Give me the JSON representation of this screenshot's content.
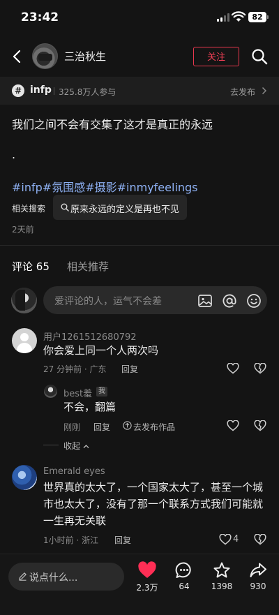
{
  "status": {
    "time": "23:42",
    "battery": "82"
  },
  "nav": {
    "username": "三治秋生",
    "follow_label": "关注"
  },
  "topic": {
    "name": "infp",
    "count": "325.8万人参与",
    "action": "去发布"
  },
  "post": {
    "text": "我们之间不会有交集了这才是真正的永远",
    "dot": ".",
    "hashtags": [
      "#infp",
      "#氛围感",
      "#摄影",
      "#inmyfeelings"
    ],
    "related_label": "相关搜索",
    "related_query": "原来永远的定义是再也不见",
    "time": "2天前"
  },
  "tabs": {
    "comments_label": "评论",
    "comments_count": "65",
    "related_label": "相关推荐"
  },
  "comment_input": {
    "placeholder": "爱评论的人，运气不会差"
  },
  "comments": [
    {
      "user": "用户1261512680792",
      "text": "你会爱上同一个人两次吗",
      "meta": "27 分钟前 · 广东",
      "reply_label": "回复",
      "likes": ""
    },
    {
      "user": "Emerald eyes",
      "text": "世界真的太大了，一个国家太大了，甚至一个城市也太大了，没有了那一个联系方式我们可能就一生再无关联",
      "meta": "1小时前 · 浙江",
      "reply_label": "回复",
      "likes": "4"
    }
  ],
  "reply": {
    "user": "best羞",
    "tag": "我",
    "text": "不会，翻篇",
    "meta": "刚刚",
    "reply_label": "回复",
    "upload_label": "去发布作品",
    "collapse_label": "收起"
  },
  "bottom": {
    "say_placeholder": "说点什么...",
    "likes": "2.3万",
    "comments": "64",
    "favorites": "1398",
    "shares": "930"
  },
  "colors": {
    "accent": "#f33f56",
    "hashtag": "#8fb2f5",
    "like_heart": "#ff2e55"
  }
}
